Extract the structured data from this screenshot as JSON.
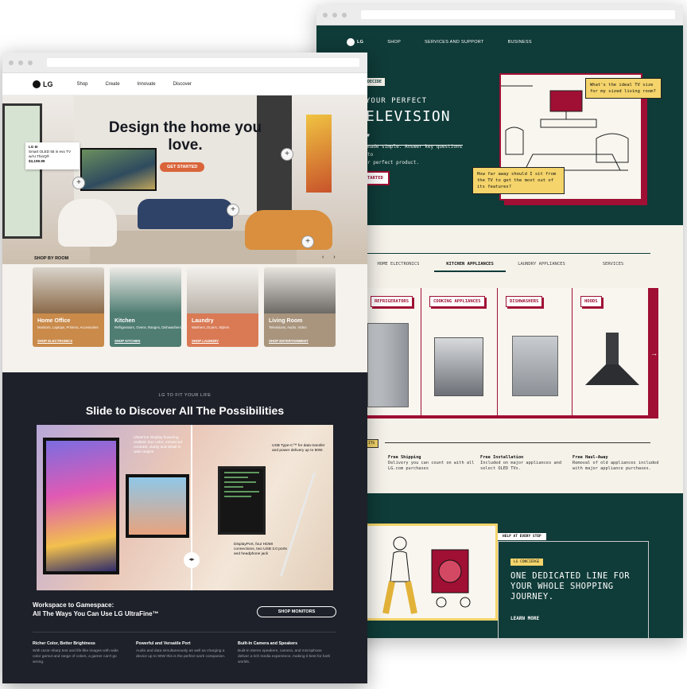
{
  "back": {
    "nav": {
      "logo": "LG",
      "items": [
        "SHOP",
        "SERVICES AND SUPPORT",
        "BUSINESS"
      ]
    },
    "hero": {
      "tag": "DECIDE",
      "line1": "YOUR PERFECT",
      "line2": "ELEVISION",
      "dropdown_icon": "chevron-down-icon",
      "body": "made simple. Answer key questions to\nr perfect product.",
      "cta": "TARTED",
      "bubble1": "What's the ideal TV size for my sized living room?",
      "bubble2": "How far away should I sit from the TV to get the most out of its features?"
    },
    "categories": [
      "HOME ELECTRONICS",
      "KITCHEN APPLIANCES",
      "LAUNDRY APPLIANCES",
      "SERVICES"
    ],
    "active_category": "KITCHEN APPLIANCES",
    "appliances": [
      "REFRIGERATORS",
      "COOKING APPLIANCES",
      "DISHWASHERS",
      "HOODS"
    ],
    "benefits_tag": "ITS",
    "benefits": [
      {
        "title": "Free Shipping",
        "text": "Delivery you can count on with all LG.com purchases"
      },
      {
        "title": "Free Installation",
        "text": "Included on major appliances and select OLED TVs."
      },
      {
        "title": "Free Haul-Away",
        "text": "Removal of old appliances included with major appliance purchases."
      }
    ],
    "concierge": {
      "help_tag": "HELP AT EVERY STEP",
      "lg_tag": "LG CONCIERGE",
      "headline": "ONE DEDICATED LINE FOR YOUR WHOLE SHOPPING JOURNEY.",
      "link": "LEARN MORE"
    }
  },
  "front": {
    "nav": {
      "logo": "LG",
      "items": [
        "Shop",
        "Create",
        "Innovate",
        "Discover"
      ]
    },
    "hero": {
      "title": "Design the home you love.",
      "cta": "GET STARTED",
      "product": {
        "brand": "LG 6I",
        "name": "Smart OLED 55 in evo TV w/AI ThinQ®",
        "price": "$3,199.99"
      },
      "shop_by_room": "SHOP BY ROOM",
      "arrows": "‹ ›"
    },
    "rooms": [
      {
        "name": "Home Office",
        "sub": "Monitors, Laptops, Printers, Accessories",
        "cta": "SHOP ELECTRONICS",
        "color": "#c98a4a"
      },
      {
        "name": "Kitchen",
        "sub": "Refrigerators, Ovens, Ranges, Dishwashers",
        "cta": "SHOP KITCHEN",
        "color": "#4f7d72"
      },
      {
        "name": "Laundry",
        "sub": "Washers, Dryers, Stylers",
        "cta": "SHOP LAUNDRY",
        "color": "#d97a55"
      },
      {
        "name": "Living Room",
        "sub": "Televisions, Audio, Video",
        "cta": "SHOP ENTERTAINMENT",
        "color": "#a9957d"
      }
    ],
    "dark": {
      "sub": "LG TO FIT YOUR LIFE",
      "title": "Slide to Discover All The Possibilities",
      "callout1": "USB Type-C™ for data transfer and power delivery up to 90W.",
      "callout2": "DisplayPort, four HDMI connections, two USB 3.0 ports and headphone jack",
      "callout3": "UltraFine Display featuring realistic true color, enhanced contrast, clarity and detail in wide angles",
      "ws_title": "Workspace to Gamespace:\nAll The Ways You Can Use LG UltraFine™",
      "shop_cta": "SHOP MONITORS",
      "features": [
        {
          "title": "Richer Color, Better Brightness",
          "text": "With razor-sharp text and life-like images with wide color gamut and range of colors, a gamer can't go wrong."
        },
        {
          "title": "Powerful and Versatile Port",
          "text": "Audio and data simultaneously as well as charging a device up to 90W this is the perfect work companion."
        },
        {
          "title": "Built-In Camera and Speakers",
          "text": "Built-in stereo speakers, camera, and microphone deliver a rich media experience, making it best for both worlds."
        }
      ]
    }
  },
  "colors": {
    "lg_green": "#0f3b38",
    "lg_red": "#a00f34",
    "accent_yellow": "#f4d46b",
    "dark_bg": "#1e212a"
  }
}
